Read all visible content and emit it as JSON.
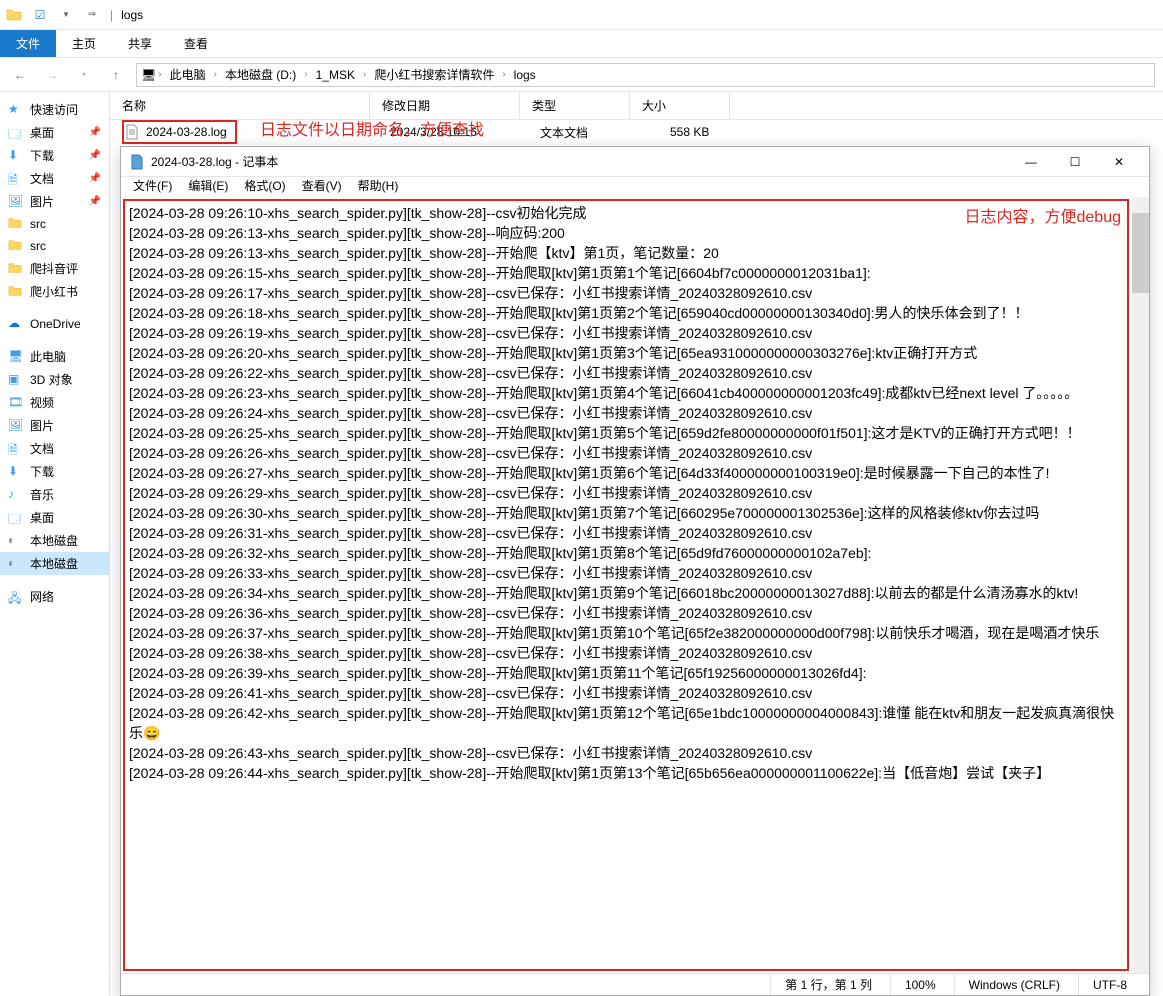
{
  "explorer": {
    "title_path": "logs",
    "ribbon": {
      "file": "文件",
      "home": "主页",
      "share": "共享",
      "view": "查看"
    },
    "breadcrumbs": [
      "此电脑",
      "本地磁盘 (D:)",
      "1_MSK",
      "爬小红书搜索详情软件",
      "logs"
    ],
    "columns": {
      "name": "名称",
      "date": "修改日期",
      "type": "类型",
      "size": "大小"
    },
    "file": {
      "name": "2024-03-28.log",
      "date": "2024/3/28 10:16",
      "type": "文本文档",
      "size": "558 KB"
    },
    "sidebar": {
      "quick": "快速访问",
      "items1": [
        "桌面",
        "下载",
        "文档",
        "图片",
        "src",
        "src",
        "爬抖音评",
        "爬小红书"
      ],
      "onedrive": "OneDrive",
      "thispc": "此电脑",
      "items2": [
        "3D 对象",
        "视频",
        "图片",
        "文档",
        "下载",
        "音乐",
        "桌面",
        "本地磁盘",
        "本地磁盘"
      ],
      "network": "网络"
    }
  },
  "annotations": {
    "a1": "日志文件以日期命名，方便查找",
    "a2": "日志内容，方便debug"
  },
  "notepad": {
    "title": "2024-03-28.log - 记事本",
    "menu": {
      "file": "文件(F)",
      "edit": "编辑(E)",
      "format": "格式(O)",
      "view": "查看(V)",
      "help": "帮助(H)"
    },
    "status": {
      "pos": "第 1 行，第 1 列",
      "zoom": "100%",
      "eol": "Windows (CRLF)",
      "enc": "UTF-8"
    },
    "lines": [
      "[2024-03-28 09:26:10-xhs_search_spider.py][tk_show-28]--csv初始化完成",
      "[2024-03-28 09:26:13-xhs_search_spider.py][tk_show-28]--响应码:200",
      "[2024-03-28 09:26:13-xhs_search_spider.py][tk_show-28]--开始爬【ktv】第1页，笔记数量：20",
      "[2024-03-28 09:26:15-xhs_search_spider.py][tk_show-28]--开始爬取[ktv]第1页第1个笔记[6604bf7c0000000012031ba1]:",
      "[2024-03-28 09:26:17-xhs_search_spider.py][tk_show-28]--csv已保存：小红书搜索详情_20240328092610.csv",
      "[2024-03-28 09:26:18-xhs_search_spider.py][tk_show-28]--开始爬取[ktv]第1页第2个笔记[659040cd00000000130340d0]:男人的快乐体会到了！！",
      "[2024-03-28 09:26:19-xhs_search_spider.py][tk_show-28]--csv已保存：小红书搜索详情_20240328092610.csv",
      "[2024-03-28 09:26:20-xhs_search_spider.py][tk_show-28]--开始爬取[ktv]第1页第3个笔记[65ea9310000000000303276e]:ktv正确打开方式",
      "[2024-03-28 09:26:22-xhs_search_spider.py][tk_show-28]--csv已保存：小红书搜索详情_20240328092610.csv",
      "[2024-03-28 09:26:23-xhs_search_spider.py][tk_show-28]--开始爬取[ktv]第1页第4个笔记[66041cb400000000001203fc49]:成都ktv已经next level 了。。。。。",
      "[2024-03-28 09:26:24-xhs_search_spider.py][tk_show-28]--csv已保存：小红书搜索详情_20240328092610.csv",
      "[2024-03-28 09:26:25-xhs_search_spider.py][tk_show-28]--开始爬取[ktv]第1页第5个笔记[659d2fe80000000000f01f501]:这才是KTV的正确打开方式吧！！",
      "[2024-03-28 09:26:26-xhs_search_spider.py][tk_show-28]--csv已保存：小红书搜索详情_20240328092610.csv",
      "[2024-03-28 09:26:27-xhs_search_spider.py][tk_show-28]--开始爬取[ktv]第1页第6个笔记[64d33f400000000100319e0]:是时候暴露一下自己的本性了!",
      "[2024-03-28 09:26:29-xhs_search_spider.py][tk_show-28]--csv已保存：小红书搜索详情_20240328092610.csv",
      "[2024-03-28 09:26:30-xhs_search_spider.py][tk_show-28]--开始爬取[ktv]第1页第7个笔记[660295e700000001302536e]:这样的风格装修ktv你去过吗",
      "[2024-03-28 09:26:31-xhs_search_spider.py][tk_show-28]--csv已保存：小红书搜索详情_20240328092610.csv",
      "[2024-03-28 09:26:32-xhs_search_spider.py][tk_show-28]--开始爬取[ktv]第1页第8个笔记[65d9fd76000000000102a7eb]:",
      "[2024-03-28 09:26:33-xhs_search_spider.py][tk_show-28]--csv已保存：小红书搜索详情_20240328092610.csv",
      "[2024-03-28 09:26:34-xhs_search_spider.py][tk_show-28]--开始爬取[ktv]第1页第9个笔记[66018bc20000000013027d88]:以前去的都是什么清汤寡水的ktv!",
      "[2024-03-28 09:26:36-xhs_search_spider.py][tk_show-28]--csv已保存：小红书搜索详情_20240328092610.csv",
      "[2024-03-28 09:26:37-xhs_search_spider.py][tk_show-28]--开始爬取[ktv]第1页第10个笔记[65f2e382000000000d00f798]:以前快乐才喝酒，现在是喝酒才快乐",
      "[2024-03-28 09:26:38-xhs_search_spider.py][tk_show-28]--csv已保存：小红书搜索详情_20240328092610.csv",
      "[2024-03-28 09:26:39-xhs_search_spider.py][tk_show-28]--开始爬取[ktv]第1页第11个笔记[65f19256000000013026fd4]:",
      "[2024-03-28 09:26:41-xhs_search_spider.py][tk_show-28]--csv已保存：小红书搜索详情_20240328092610.csv",
      "[2024-03-28 09:26:42-xhs_search_spider.py][tk_show-28]--开始爬取[ktv]第1页第12个笔记[65e1bdc10000000004000843]:谁懂 能在ktv和朋友一起发疯真滴很快乐😄",
      "[2024-03-28 09:26:43-xhs_search_spider.py][tk_show-28]--csv已保存：小红书搜索详情_20240328092610.csv",
      "[2024-03-28 09:26:44-xhs_search_spider.py][tk_show-28]--开始爬取[ktv]第1页第13个笔记[65b656ea000000001100622e]:当【低音炮】尝试【夹子】"
    ]
  }
}
